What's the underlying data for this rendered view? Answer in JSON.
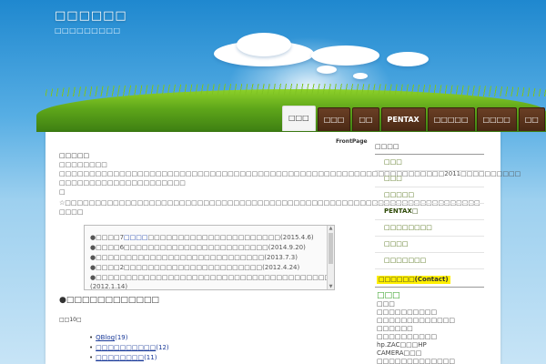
{
  "header": {
    "site_title": "□□□□□□",
    "site_subtitle": "□□□□□□□□□"
  },
  "nav": {
    "items": [
      {
        "label": "□□□",
        "active": true
      },
      {
        "label": "□□□",
        "active": false
      },
      {
        "label": "□□",
        "active": false
      },
      {
        "label": "PENTAX",
        "active": false
      },
      {
        "label": "□□□□□",
        "active": false
      },
      {
        "label": "□□□□",
        "active": false
      },
      {
        "label": "□□",
        "active": false
      }
    ]
  },
  "breadcrumb": "FrontPage",
  "main": {
    "heading": "□□□□□",
    "subheading": "□□□□□□□□",
    "paragraph_line1": "□□□□□□□□□□□□□□□□□□□□□□□□□□□□□□□□□□□□□□□□□□□□□□□□□□□□□□□□□□□□□□□□2011□□□□□□□□□□",
    "paragraph_line2": "□□□□□□□□□□□□□□□□□□□□□",
    "paragraph_line3": "□",
    "notice_line": "☆□□□□□□□□□□□□□□□□□□□□□□□□□□□□□□□□□□□□□□□□□□□□□□□□□□□□□□□□□□□□□□□□□□□□□",
    "notice_link": "□□□□",
    "news": [
      {
        "prefix": "●□□□□7",
        "highlight": "□□□□",
        "text": "□□□□□□□□□□□□□□□□□□□□□□(2015.4.6)"
      },
      {
        "prefix": "●□□□□6",
        "highlight": "",
        "text": "□□□□□□□□□□□□□□□□□□□□□□□□(2014.9.20)"
      },
      {
        "prefix": "●□□□□□",
        "highlight": "",
        "text": "□□□□□□□□□□□□□□□□□□□□□□□(2013.7.3)"
      },
      {
        "prefix": "●□□□□2",
        "highlight": "",
        "text": "□□□□□□□□□□□□□□□□□□□□□□□(2012.4.24)"
      },
      {
        "prefix": "●□□□□□",
        "highlight": "",
        "text": "□□□□□□□□□□□□□□□□□□□□□□□□□□□□□□□□□□□□□"
      },
      {
        "prefix": "",
        "highlight": "",
        "text": "(2012.1.14)"
      }
    ],
    "section_title": "●□□□□□□□□□□□□",
    "section_count_label": "□□10□",
    "blog_links": [
      {
        "label": "QBlog",
        "count": "(19)"
      },
      {
        "label": "□□□□□□□□□□",
        "count": "(12)"
      },
      {
        "label": "□□□□□□□□",
        "count": "(11)"
      }
    ]
  },
  "sidebar": {
    "head": "□□□□",
    "items": [
      {
        "label": "□□□",
        "bold": false
      },
      {
        "label": "□□□",
        "bold": false
      },
      {
        "label": "□□□□□",
        "bold": false
      },
      {
        "label": "PENTAX□",
        "bold": true
      },
      {
        "label": "□□□□□□□□",
        "bold": false
      },
      {
        "label": "□□□□",
        "bold": false
      },
      {
        "label": "□□□□□□□",
        "bold": false
      }
    ],
    "contact_label": "□□□□□□(Contact)",
    "green_head": "□□□",
    "plain_lines": [
      "□□□",
      "□□□□□□□□□□",
      "□□□□□□□□□□□□□",
      "□□□□□□",
      "□□□□□□□□□□",
      "hp.ZAC□□□HP",
      "CAMERA□□□",
      "□□□□□□□□□□□□□"
    ]
  }
}
